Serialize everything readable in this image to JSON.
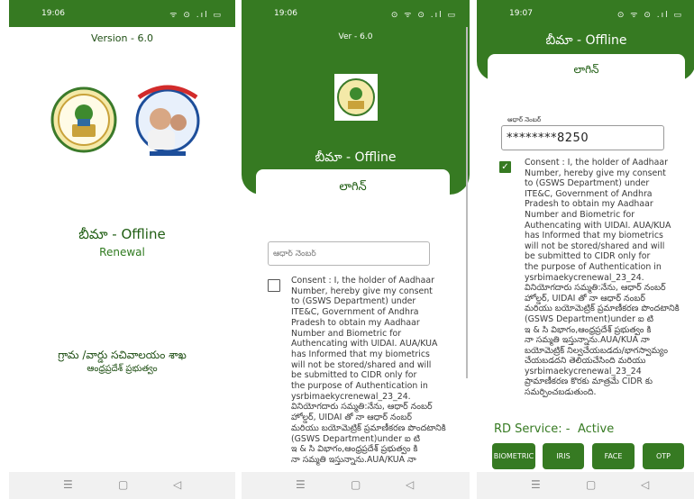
{
  "screen1": {
    "time": "19:06",
    "status_icons": "ᯤ ⊙ .ıl ▭",
    "version": "Version - 6.0",
    "app_title": "బీమా - Offline",
    "subtitle": "Renewal",
    "department": "గ్రామ /వార్డు సచివాలయం శాఖ",
    "state": "ఆంధ్రప్రదేశ్ ప్రభుత్వం"
  },
  "screen2": {
    "time": "19:06",
    "status_icons": "⊙ ᯤ ⊙ .ıl ▭",
    "version": "Ver - 6.0",
    "app_title": "బీమా - Offline",
    "login_title": "లాగిన్",
    "aadhaar_placeholder": "ఆధార్ నెంబర్",
    "consent_text": "Consent : I, the holder of Aadhaar\nNumber, hereby give my consent\nto (GSWS Department) under\nITE&C, Government of Andhra\nPradesh to obtain my Aadhaar\nNumber and Biometric for\nAuthencating with UIDAI. AUA/KUA\nhas Informed that my biometrics\nwill not be stored/shared and will\nbe submitted to CIDR only for\nthe purpose of Authentication in\nysrbimaekycrenewal_23_24.\nవినియోగదారు సమ్మతి:నేను, ఆధార్ నంబర్\nహోల్డర్, UIDAI తో నా ఆధార్ నంబర్\nమరియు బయోమెట్రిక్ ప్రమాణీకరణ పొందటానికి\n(GSWS Department)under ఐ టి\nఇ & సి విభాగం,ఆంధ్రప్రదేశ్ ప్రభుత్వం కి\nనా సమ్మతి ఇస్తున్నాను.AUA/KUA నా"
  },
  "screen3": {
    "time": "19:07",
    "status_icons": "⊙ ᯤ ⊙ .ıl ▭",
    "app_title": "బీమా - Offline",
    "login_title": "లాగిన్",
    "aadhaar_label": "ఆధార్ నెంబర్",
    "aadhaar_value": "********8250",
    "consent_checked": true,
    "consent_text": "Consent : I, the holder of Aadhaar\nNumber, hereby give my consent\nto (GSWS Department) under\nITE&C, Government of Andhra\nPradesh to obtain my Aadhaar\nNumber and Biometric for\nAuthencating with UIDAI. AUA/KUA\nhas Informed that my biometrics\nwill not be stored/shared and will\nbe submitted to CIDR only for\nthe purpose of Authentication in\nysrbimaekycrenewal_23_24.\nవినియోగదారు సమ్మతి:నేను, ఆధార్ నంబర్\nహోల్డర్, UIDAI తో నా ఆధార్ నంబర్\nమరియు బయోమెట్రిక్ ప్రమాణీకరణ పొందటానికి\n(GSWS Department)under ఐ టి\nఇ & సి విభాగం,ఆంధ్రప్రదేశ్ ప్రభుత్వం కి\nనా సమ్మతి ఇస్తున్నాను.AUA/KUA నా\nబయోమెట్రిక్ నిల్వచేయబడదు/భాగస్వామ్యం\nచేయబడదని తెలియచేసింది మరియు\nysrbimaekycrenewal_23_24\nప్రామాణీకరణ కొరకు మాత్రమే CIDR కు\nసమర్పించబడుతుంది.",
    "rd_label": "RD Service: -",
    "rd_status": "Active",
    "buttons": {
      "biometric": "BIOMETRIC",
      "iris": "IRIS",
      "face": "FACE",
      "otp": "OTP"
    }
  },
  "nav": {
    "menu": "☰",
    "home": "▢",
    "back": "◁"
  },
  "colors": {
    "primary_green": "#367a22",
    "dark_green_text": "#1f5d12"
  }
}
